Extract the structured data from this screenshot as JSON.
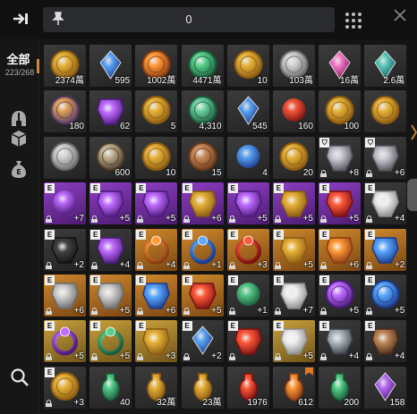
{
  "header": {
    "pinned_count": "0"
  },
  "sidebar": {
    "all_label": "全部",
    "all_count": "223/268",
    "categories": [
      {
        "name": "helmet-icon"
      },
      {
        "name": "box-icon"
      },
      {
        "name": "money-bag-icon"
      }
    ]
  },
  "colors": {
    "gray": "#3c3c3c",
    "purple": "#8e3fc4",
    "orange": "#d08a2e",
    "gold": "#c9a13c",
    "accent": "#c98a3a"
  },
  "inventory": [
    {
      "icon": "gold-coin",
      "rarity": "gray",
      "qty": "2374萬"
    },
    {
      "icon": "blue-diamond",
      "rarity": "gray",
      "qty": "595"
    },
    {
      "icon": "amber-leaf-coin",
      "rarity": "gray",
      "qty": "1002萬"
    },
    {
      "icon": "green-fleur-coin",
      "rarity": "gray",
      "qty": "4471萬"
    },
    {
      "icon": "gold-coin",
      "rarity": "gray",
      "qty": "10"
    },
    {
      "icon": "silver-coin",
      "rarity": "gray",
      "qty": "103萬"
    },
    {
      "icon": "pink-crystal",
      "rarity": "gray",
      "qty": "16萬"
    },
    {
      "icon": "teal-crystal",
      "rarity": "gray",
      "qty": "2.6萬"
    },
    {
      "icon": "mosaic-coin",
      "rarity": "gray",
      "qty": "180"
    },
    {
      "icon": "purple-emblem",
      "rarity": "gray",
      "qty": "62"
    },
    {
      "icon": "gold-rune-coin",
      "rarity": "gray",
      "qty": "5"
    },
    {
      "icon": "jade-medallion",
      "rarity": "gray",
      "qty": "4,310"
    },
    {
      "icon": "blue-shard",
      "rarity": "gray",
      "qty": "545"
    },
    {
      "icon": "red-ember",
      "rarity": "gray",
      "qty": "160"
    },
    {
      "icon": "gold-coin",
      "rarity": "gray",
      "qty": "100"
    },
    {
      "icon": "gold-coin",
      "rarity": "gray",
      "qty": ""
    },
    {
      "icon": "silver-coin",
      "rarity": "gray",
      "qty": ""
    },
    {
      "icon": "gear-medallion",
      "rarity": "gray",
      "qty": "600"
    },
    {
      "icon": "gold-rune-coin",
      "rarity": "gray",
      "qty": "10"
    },
    {
      "icon": "bronze-coin",
      "rarity": "gray",
      "qty": "15"
    },
    {
      "icon": "blue-orb",
      "rarity": "gray",
      "qty": "4"
    },
    {
      "icon": "gold-hex-coin",
      "rarity": "gray",
      "qty": "20"
    },
    {
      "icon": "crossbow",
      "rarity": "gray",
      "qty": "+8",
      "tag": "shield",
      "lock": true
    },
    {
      "icon": "claw",
      "rarity": "gray",
      "qty": "+6",
      "tag": "shield",
      "lock": true
    },
    {
      "icon": "purple-rune-disc",
      "rarity": "purple",
      "qty": "+7",
      "tag": "E",
      "lock": true
    },
    {
      "icon": "purple-robe",
      "rarity": "purple",
      "qty": "+5",
      "tag": "E",
      "lock": true
    },
    {
      "icon": "purple-armor",
      "rarity": "purple",
      "qty": "+5",
      "tag": "E",
      "lock": true
    },
    {
      "icon": "gold-pauldron",
      "rarity": "purple",
      "qty": "+6",
      "tag": "E",
      "lock": true
    },
    {
      "icon": "purple-wings",
      "rarity": "purple",
      "qty": "+5",
      "tag": "E",
      "lock": true
    },
    {
      "icon": "gold-gauntlet",
      "rarity": "purple",
      "qty": "+5",
      "tag": "E",
      "lock": true
    },
    {
      "icon": "red-armor",
      "rarity": "purple",
      "qty": "+5",
      "tag": "E",
      "lock": true
    },
    {
      "icon": "white-claw",
      "rarity": "gray",
      "qty": "+4",
      "tag": "E",
      "lock": true
    },
    {
      "icon": "black-scarf",
      "rarity": "gray",
      "qty": "+2",
      "tag": "E",
      "lock": true
    },
    {
      "icon": "purple-bow",
      "rarity": "gray",
      "qty": "+4",
      "tag": "E",
      "lock": true
    },
    {
      "icon": "orange-ring",
      "rarity": "orange",
      "qty": "+4",
      "tag": "E",
      "lock": true
    },
    {
      "icon": "blue-gem-ring",
      "rarity": "orange",
      "qty": "+1",
      "tag": "E",
      "lock": true
    },
    {
      "icon": "red-gem-ring",
      "rarity": "orange",
      "qty": "+3",
      "tag": "E",
      "lock": true
    },
    {
      "icon": "gold-gloves",
      "rarity": "orange",
      "qty": "+5",
      "tag": "E",
      "lock": true
    },
    {
      "icon": "orange-arm-guard",
      "rarity": "orange",
      "qty": "+6",
      "tag": "E",
      "lock": true
    },
    {
      "icon": "blue-wings",
      "rarity": "orange",
      "qty": "+2",
      "tag": "E",
      "lock": true
    },
    {
      "icon": "silver-shoulder",
      "rarity": "orange",
      "qty": "+6",
      "tag": "E",
      "lock": true
    },
    {
      "icon": "silver-shoulder-2",
      "rarity": "orange",
      "qty": "+5",
      "tag": "E",
      "lock": true
    },
    {
      "icon": "blue-amulet",
      "rarity": "orange",
      "qty": "+6",
      "tag": "E",
      "lock": true
    },
    {
      "icon": "red-amulet",
      "rarity": "orange",
      "qty": "+5",
      "tag": "E",
      "lock": true
    },
    {
      "icon": "green-pentagram",
      "rarity": "gray",
      "qty": "+1",
      "tag": "E",
      "lock": true
    },
    {
      "icon": "white-robe",
      "rarity": "gray",
      "qty": "+7",
      "tag": "E",
      "lock": true
    },
    {
      "icon": "purple-rune-coin",
      "rarity": "gray",
      "qty": "+5",
      "tag": "E",
      "lock": true
    },
    {
      "icon": "blue-rune-coin",
      "rarity": "gray",
      "qty": "+5",
      "tag": "E",
      "lock": true
    },
    {
      "icon": "purple-gem-ring",
      "rarity": "gold",
      "qty": "+5",
      "tag": "E",
      "lock": true
    },
    {
      "icon": "green-gem-ring",
      "rarity": "gold",
      "qty": "+5",
      "tag": "E",
      "lock": true
    },
    {
      "icon": "gold-pendant",
      "rarity": "gold",
      "qty": "+3",
      "tag": "E",
      "lock": true
    },
    {
      "icon": "blue-crystal-charm",
      "rarity": "gray",
      "qty": "+2",
      "tag": "E",
      "lock": true
    },
    {
      "icon": "red-dragon-helm",
      "rarity": "gray",
      "qty": "",
      "tag": "E",
      "lock": true
    },
    {
      "icon": "white-skirt",
      "rarity": "gold",
      "qty": "+5",
      "tag": "E",
      "lock": true
    },
    {
      "icon": "steel-gauntlet",
      "rarity": "gray",
      "qty": "+4",
      "tag": "E",
      "lock": true
    },
    {
      "icon": "spellbook",
      "rarity": "gray",
      "qty": "+4",
      "tag": "E",
      "lock": true
    },
    {
      "icon": "gold-medallion",
      "rarity": "gray",
      "qty": "+3",
      "tag": "E",
      "lock": true
    },
    {
      "icon": "green-chalice",
      "rarity": "gray",
      "qty": "40"
    },
    {
      "icon": "gold-chalice",
      "rarity": "gray",
      "qty": "32萬"
    },
    {
      "icon": "gold-chalice",
      "rarity": "gray",
      "qty": "23萬"
    },
    {
      "icon": "red-potion",
      "rarity": "gray",
      "qty": "1976"
    },
    {
      "icon": "orange-potion",
      "rarity": "gray",
      "qty": "612",
      "flag": true
    },
    {
      "icon": "green-potion",
      "rarity": "gray",
      "qty": "200"
    },
    {
      "icon": "purple-crystals",
      "rarity": "gray",
      "qty": "158"
    }
  ]
}
